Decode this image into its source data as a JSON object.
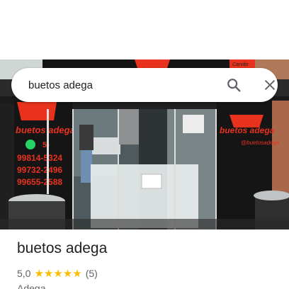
{
  "search": {
    "value": "buetos adega",
    "search_icon": "search-icon",
    "close_icon": "close-icon"
  },
  "photo": {
    "sign_top_right": "Carvão",
    "brand_left": "buetos adega",
    "brand_right": "buetos adega",
    "handle_right": "@buetosadega",
    "phone_numbers": [
      "99814-5324",
      "99732-2496",
      "99655-2588"
    ],
    "phone_partial": "5)",
    "whatsapp_icon": "whatsapp-icon"
  },
  "place": {
    "title": "buetos adega",
    "rating": "5,0",
    "stars": 5,
    "reviews": "(5)",
    "category": "Adega"
  },
  "colors": {
    "accent_red": "#e8321e",
    "star_yellow": "#fbbc04",
    "whatsapp_green": "#25d366"
  }
}
